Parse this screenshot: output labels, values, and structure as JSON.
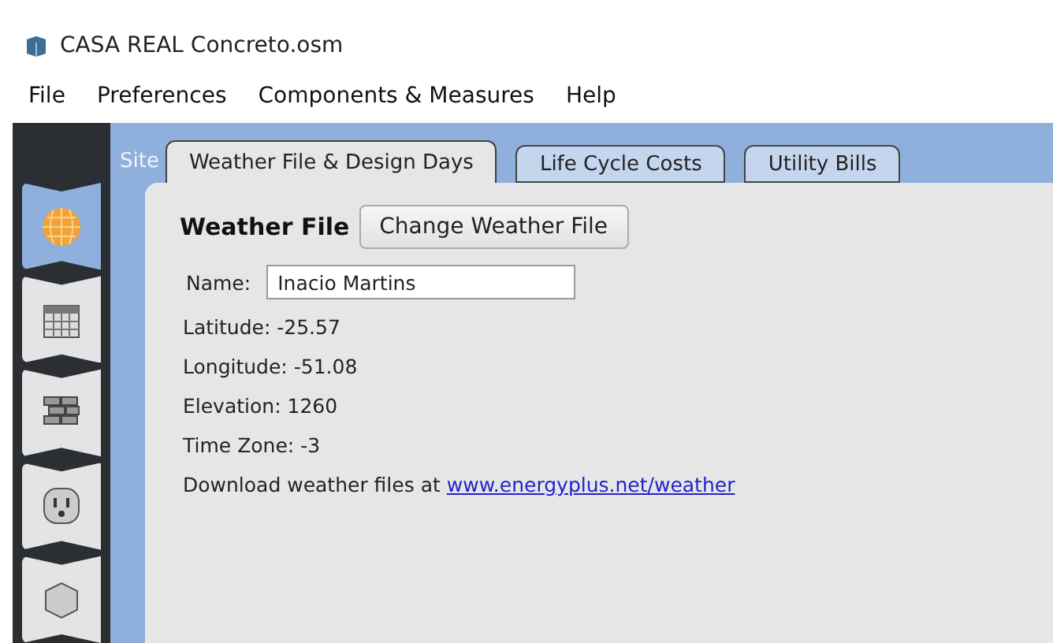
{
  "window": {
    "title": "CASA REAL Concreto.osm"
  },
  "menu": [
    "File",
    "Preferences",
    "Components & Measures",
    "Help"
  ],
  "sidebar": {
    "items": [
      {
        "selected": true
      },
      {
        "selected": false
      },
      {
        "selected": false
      },
      {
        "selected": false
      },
      {
        "selected": false
      }
    ]
  },
  "section_label": "Site",
  "tabs": [
    {
      "label": "Weather File & Design Days",
      "selected": true
    },
    {
      "label": "Life Cycle Costs",
      "selected": false
    },
    {
      "label": "Utility Bills",
      "selected": false
    }
  ],
  "weather_file": {
    "heading": "Weather File",
    "button": "Change Weather File",
    "name_label": "Name:",
    "name_value": "Inacio Martins",
    "fields": [
      "Latitude: -25.57",
      "Longitude: -51.08",
      "Elevation: 1260",
      "Time Zone: -3"
    ],
    "download_text": "Download weather files at",
    "download_link": "www.energyplus.net/weather"
  }
}
